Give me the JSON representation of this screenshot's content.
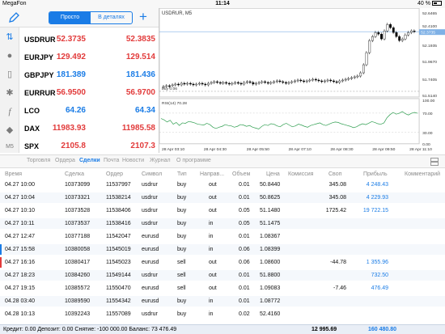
{
  "status": {
    "carrier": "MegaFon",
    "time": "11:14",
    "battery": "40 %"
  },
  "toolbar": {
    "simple": "Просто",
    "details": "В деталях"
  },
  "quotes": [
    {
      "sym": "USDRUR",
      "bid": "52.3735",
      "ask": "52.3835",
      "bc": "red",
      "ac": "red"
    },
    {
      "sym": "EURJPY",
      "bid": "129.492",
      "ask": "129.514",
      "bc": "red",
      "ac": "red"
    },
    {
      "sym": "GBPJPY",
      "bid": "181.389",
      "ask": "181.436",
      "bc": "blue",
      "ac": "blue"
    },
    {
      "sym": "EURRUR",
      "bid": "56.9500",
      "ask": "56.9700",
      "bc": "red",
      "ac": "red"
    },
    {
      "sym": "LCO",
      "bid": "64.26",
      "ask": "64.34",
      "bc": "blue",
      "ac": "blue"
    },
    {
      "sym": "DAX",
      "bid": "11983.93",
      "ask": "11985.58",
      "bc": "red",
      "ac": "red"
    },
    {
      "sym": "SPX",
      "bid": "2105.8",
      "ask": "2107.3",
      "bc": "red",
      "ac": "red"
    }
  ],
  "chart": {
    "title": "USDRUR, M5",
    "rsi_label": "RSI(14) 70.28",
    "order_label": "buy 0.06",
    "price_ticks": [
      "52.6465",
      "52.4100",
      "52.3735",
      "52.1935",
      "51.9670",
      "51.7405",
      "51.5140"
    ],
    "rsi_ticks": [
      "100.00",
      "70.00",
      "30.00",
      "0.00"
    ],
    "time_ticks": [
      "28 Apr 03:10",
      "28 Apr 04:30",
      "28 Apr 05:50",
      "28 Apr 07:10",
      "28 Apr 08:30",
      "28 Apr 09:50",
      "28 Apr 11:10"
    ],
    "rsi_values": [
      58,
      55,
      50,
      54,
      45,
      49,
      42,
      48,
      47,
      51,
      50,
      48,
      45,
      44,
      43,
      47,
      44,
      38,
      35,
      38,
      40,
      44,
      42,
      41,
      38,
      40,
      44,
      43,
      40,
      42,
      38,
      36,
      34,
      40,
      44,
      42,
      46,
      45,
      41,
      39,
      44,
      47,
      43,
      39,
      41,
      45,
      43,
      40,
      38,
      42,
      44,
      46,
      48,
      44,
      42,
      45,
      48,
      50,
      49,
      46,
      44,
      42,
      40,
      37,
      39,
      43,
      46,
      44,
      47,
      51,
      49,
      46,
      45,
      48,
      60,
      67,
      72,
      68,
      70,
      74,
      69,
      66,
      70,
      72,
      70
    ],
    "last_price": "52.3735"
  },
  "tabs": [
    "Торговля",
    "Ордера",
    "Сделки",
    "Почта",
    "Новости",
    "Журнал",
    "О программе"
  ],
  "active_tab": "Сделки",
  "columns": [
    "Время",
    "Сделка",
    "Ордер",
    "Символ",
    "Тип",
    "Направ...",
    "Объем",
    "Цена",
    "Комиссия",
    "Своп",
    "Прибыль",
    "Комментарий"
  ],
  "rows": [
    {
      "time": "04.27 10:00",
      "deal": "10373099",
      "order": "11537997",
      "sym": "usdrur",
      "type": "buy",
      "dir": "out",
      "vol": "0.01",
      "price": "50.8440",
      "comm": "",
      "swap": "345.08",
      "profit": "4 248.43",
      "pc": "blue",
      "mark": ""
    },
    {
      "time": "04.27 10:04",
      "deal": "10373321",
      "order": "11538214",
      "sym": "usdrur",
      "type": "buy",
      "dir": "out",
      "vol": "0.01",
      "price": "50.8625",
      "comm": "",
      "swap": "345.08",
      "profit": "4 229.93",
      "pc": "blue",
      "mark": ""
    },
    {
      "time": "04.27 10:10",
      "deal": "10373528",
      "order": "11538406",
      "sym": "usdrur",
      "type": "buy",
      "dir": "out",
      "vol": "0.05",
      "price": "51.1480",
      "comm": "",
      "swap": "1725.42",
      "profit": "19 722.15",
      "pc": "blue",
      "mark": ""
    },
    {
      "time": "04.27 10:11",
      "deal": "10373537",
      "order": "11538416",
      "sym": "usdrur",
      "type": "buy",
      "dir": "in",
      "vol": "0.05",
      "price": "51.1475",
      "comm": "",
      "swap": "",
      "profit": "",
      "pc": "",
      "mark": ""
    },
    {
      "time": "04.27 12:47",
      "deal": "10377188",
      "order": "11542047",
      "sym": "eurusd",
      "type": "buy",
      "dir": "in",
      "vol": "0.01",
      "price": "1.08367",
      "comm": "",
      "swap": "",
      "profit": "",
      "pc": "",
      "mark": ""
    },
    {
      "time": "04.27 15:58",
      "deal": "10380058",
      "order": "11545019",
      "sym": "eurusd",
      "type": "buy",
      "dir": "in",
      "vol": "0.06",
      "price": "1.08399",
      "comm": "",
      "swap": "",
      "profit": "",
      "pc": "",
      "mark": "#1a7ce6"
    },
    {
      "time": "04.27 16:16",
      "deal": "10380417",
      "order": "11545023",
      "sym": "eurusd",
      "type": "sell",
      "dir": "out",
      "vol": "0.06",
      "price": "1.08600",
      "comm": "",
      "swap": "-44.78",
      "profit": "1 355.96",
      "pc": "blue",
      "mark": "#e23b3b"
    },
    {
      "time": "04.27 18:23",
      "deal": "10384260",
      "order": "11549144",
      "sym": "usdrur",
      "type": "sell",
      "dir": "out",
      "vol": "0.01",
      "price": "51.8800",
      "comm": "",
      "swap": "",
      "profit": "732.50",
      "pc": "blue",
      "mark": ""
    },
    {
      "time": "04.27 19:15",
      "deal": "10385572",
      "order": "11550470",
      "sym": "eurusd",
      "type": "sell",
      "dir": "out",
      "vol": "0.01",
      "price": "1.09083",
      "comm": "",
      "swap": "-7.46",
      "profit": "476.49",
      "pc": "blue",
      "mark": ""
    },
    {
      "time": "04.28 03:40",
      "deal": "10389590",
      "order": "11554342",
      "sym": "eurusd",
      "type": "buy",
      "dir": "in",
      "vol": "0.01",
      "price": "1.08772",
      "comm": "",
      "swap": "",
      "profit": "",
      "pc": "",
      "mark": ""
    },
    {
      "time": "04.28 10:13",
      "deal": "10392243",
      "order": "11557089",
      "sym": "usdrur",
      "type": "buy",
      "dir": "in",
      "vol": "0.02",
      "price": "52.4160",
      "comm": "",
      "swap": "",
      "profit": "",
      "pc": "",
      "mark": ""
    }
  ],
  "footer": {
    "summary": "Кредит: 0.00 Депозит: 0.00 Снятие: -100 000.00 Баланс: 73 476.49",
    "swap_total": "12 995.69",
    "profit_total": "160 480.80"
  }
}
